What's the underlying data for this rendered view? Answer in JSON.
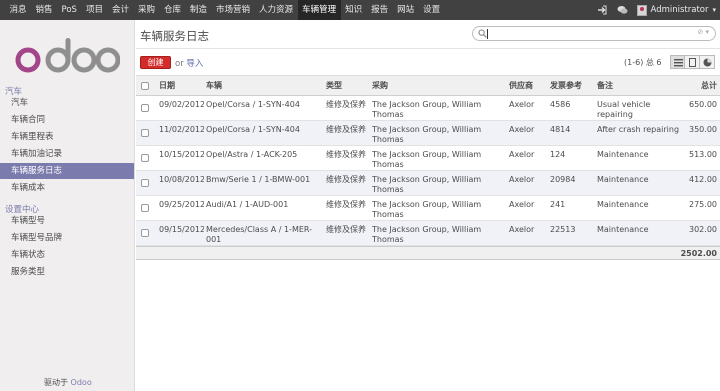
{
  "topbar": {
    "menu": [
      "消息",
      "销售",
      "PoS",
      "项目",
      "会计",
      "采购",
      "仓库",
      "制造",
      "市场营销",
      "人力资源",
      "车辆管理",
      "知识",
      "报告",
      "网站",
      "设置"
    ],
    "active_index": 10,
    "user": "Administrator"
  },
  "sidebar": {
    "logo_text": "odoo",
    "sections": [
      {
        "title": "汽车",
        "items": [
          "汽车",
          "车辆合同",
          "车辆里程表",
          "车辆加油记录",
          "车辆服务日志",
          "车辆成本"
        ]
      },
      {
        "title": "设置中心",
        "items": [
          "车辆型号",
          "车辆型号品牌",
          "车辆状态",
          "服务类型"
        ]
      }
    ],
    "active_item": "车辆服务日志",
    "powered_prefix": "驱动于",
    "powered_brand": "Odoo"
  },
  "header": {
    "title": "车辆服务日志",
    "create_label": "创建",
    "or_label": "or",
    "import_label": "导入",
    "pager": "(1-6) 总 6"
  },
  "search": {
    "value": "",
    "placeholder": ""
  },
  "table": {
    "columns": [
      "日期",
      "车辆",
      "类型",
      "采购",
      "供应商",
      "发票参考",
      "备注",
      "总计"
    ],
    "rows": [
      {
        "date": "09/02/2012",
        "vehicle": "Opel/Corsa / 1-SYN-404",
        "type": "维修及保养",
        "purchaser": "The Jackson Group, William Thomas",
        "vendor": "Axelor",
        "invoice": "4586",
        "notes": "Usual vehicle repairing",
        "total": "650.00"
      },
      {
        "date": "11/02/2012",
        "vehicle": "Opel/Corsa / 1-SYN-404",
        "type": "维修及保养",
        "purchaser": "The Jackson Group, William Thomas",
        "vendor": "Axelor",
        "invoice": "4814",
        "notes": "After crash repairing",
        "total": "350.00"
      },
      {
        "date": "10/15/2012",
        "vehicle": "Opel/Astra / 1-ACK-205",
        "type": "维修及保养",
        "purchaser": "The Jackson Group, William Thomas",
        "vendor": "Axelor",
        "invoice": "124",
        "notes": "Maintenance",
        "total": "513.00"
      },
      {
        "date": "10/08/2012",
        "vehicle": "Bmw/Serie 1 / 1-BMW-001",
        "type": "维修及保养",
        "purchaser": "The Jackson Group, William Thomas",
        "vendor": "Axelor",
        "invoice": "20984",
        "notes": "Maintenance",
        "total": "412.00"
      },
      {
        "date": "09/25/2012",
        "vehicle": "Audi/A1 / 1-AUD-001",
        "type": "维修及保养",
        "purchaser": "The Jackson Group, William Thomas",
        "vendor": "Axelor",
        "invoice": "241",
        "notes": "Maintenance",
        "total": "275.00"
      },
      {
        "date": "09/15/2012",
        "vehicle": "Mercedes/Class A / 1-MER-001",
        "type": "维修及保养",
        "purchaser": "The Jackson Group, William Thomas",
        "vendor": "Axelor",
        "invoice": "22513",
        "notes": "Maintenance",
        "total": "302.00"
      }
    ],
    "sum_total": "2502.00"
  },
  "colors": {
    "topbar": "#414141",
    "accent": "#7c7bad",
    "create_button": "#d42b2b"
  },
  "icons": [
    "logout-icon",
    "chat-icon",
    "search-icon",
    "list-view-icon",
    "form-view-icon",
    "graph-view-icon"
  ]
}
